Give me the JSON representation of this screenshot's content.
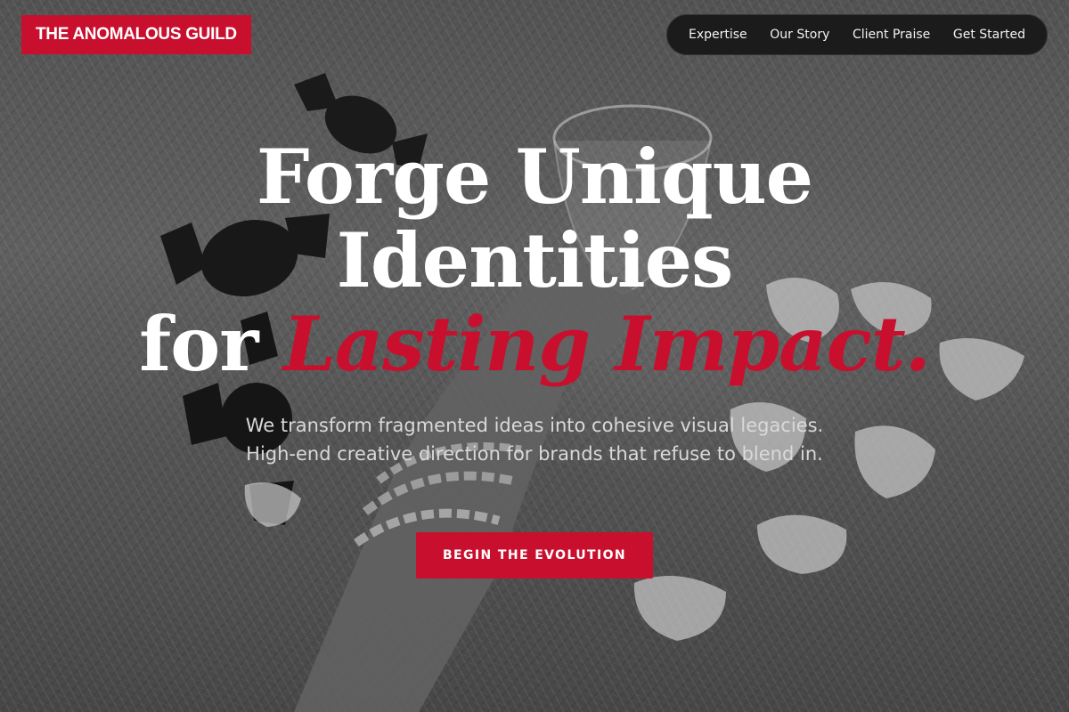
{
  "brand": {
    "name": "THE ANOMALOUS GUILD",
    "accent_color": "#c8102e"
  },
  "nav": {
    "items": [
      {
        "label": "Expertise"
      },
      {
        "label": "Our Story"
      },
      {
        "label": "Client Praise"
      },
      {
        "label": "Get Started"
      }
    ]
  },
  "hero": {
    "headline_line1": "Forge Unique",
    "headline_line2": "Identities",
    "headline_line3_plain": "for",
    "headline_line3_accent": "Lasting Impact.",
    "subtitle": "We transform fragmented ideas into cohesive visual legacies. High-end creative direction for brands that refuse to blend in.",
    "cta_label": "BEGIN THE EVOLUTION"
  }
}
